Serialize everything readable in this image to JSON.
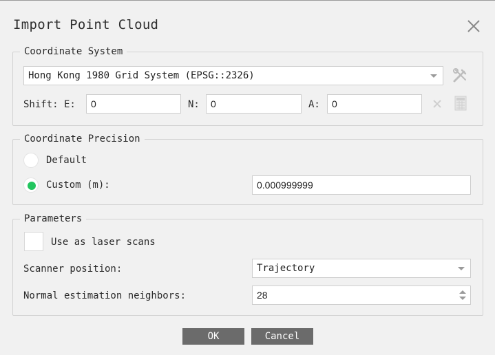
{
  "dialog": {
    "title": "Import Point Cloud"
  },
  "coordinate_system": {
    "legend": "Coordinate System",
    "selected": "Hong Kong 1980 Grid System (EPSG::2326)",
    "shift_label": "Shift: E:",
    "n_label": "N:",
    "a_label": "A:",
    "e_value": "0",
    "n_value": "0",
    "a_value": "0"
  },
  "precision": {
    "legend": "Coordinate Precision",
    "default_label": "Default",
    "custom_label": "Custom (m):",
    "custom_value": "0.000999999",
    "selected": "custom"
  },
  "parameters": {
    "legend": "Parameters",
    "laser_scans_label": "Use as laser scans",
    "laser_scans_checked": false,
    "scanner_position_label": "Scanner position:",
    "scanner_position_value": "Trajectory",
    "neighbors_label": "Normal estimation neighbors:",
    "neighbors_value": "28"
  },
  "buttons": {
    "ok": "OK",
    "cancel": "Cancel"
  },
  "colors": {
    "radio_selected": "#22c55e",
    "button_bg": "#6b6b6b"
  },
  "icons": [
    "close-icon",
    "settings-tools-icon",
    "clear-icon",
    "calculator-icon",
    "dropdown-arrow-icon",
    "spin-arrows-icon"
  ]
}
